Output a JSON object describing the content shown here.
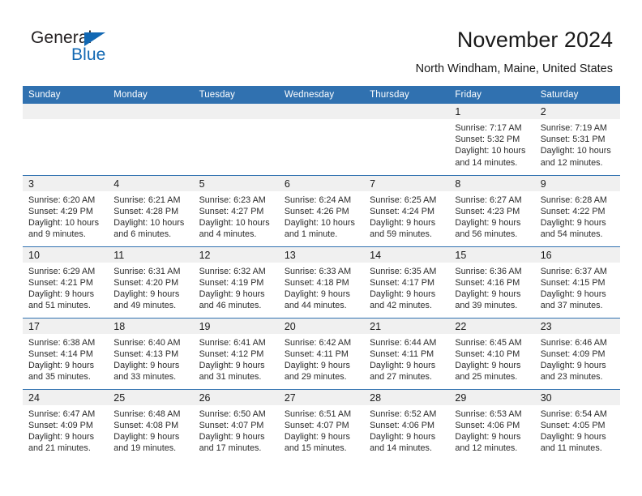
{
  "brand": {
    "name_part1": "General",
    "name_part2": "Blue",
    "accent_color": "#1268b3",
    "logo_icon": "triangle-icon"
  },
  "header": {
    "title": "November 2024",
    "subtitle": "North Windham, Maine, United States"
  },
  "calendar": {
    "header_color": "#3071b0",
    "daynum_band_color": "#f0f0f0",
    "columns": [
      "Sunday",
      "Monday",
      "Tuesday",
      "Wednesday",
      "Thursday",
      "Friday",
      "Saturday"
    ],
    "weeks": [
      [
        {
          "day": "",
          "empty": true
        },
        {
          "day": "",
          "empty": true
        },
        {
          "day": "",
          "empty": true
        },
        {
          "day": "",
          "empty": true
        },
        {
          "day": "",
          "empty": true
        },
        {
          "day": "1",
          "sunrise": "Sunrise: 7:17 AM",
          "sunset": "Sunset: 5:32 PM",
          "daylight": "Daylight: 10 hours and 14 minutes."
        },
        {
          "day": "2",
          "sunrise": "Sunrise: 7:19 AM",
          "sunset": "Sunset: 5:31 PM",
          "daylight": "Daylight: 10 hours and 12 minutes."
        }
      ],
      [
        {
          "day": "3",
          "sunrise": "Sunrise: 6:20 AM",
          "sunset": "Sunset: 4:29 PM",
          "daylight": "Daylight: 10 hours and 9 minutes."
        },
        {
          "day": "4",
          "sunrise": "Sunrise: 6:21 AM",
          "sunset": "Sunset: 4:28 PM",
          "daylight": "Daylight: 10 hours and 6 minutes."
        },
        {
          "day": "5",
          "sunrise": "Sunrise: 6:23 AM",
          "sunset": "Sunset: 4:27 PM",
          "daylight": "Daylight: 10 hours and 4 minutes."
        },
        {
          "day": "6",
          "sunrise": "Sunrise: 6:24 AM",
          "sunset": "Sunset: 4:26 PM",
          "daylight": "Daylight: 10 hours and 1 minute."
        },
        {
          "day": "7",
          "sunrise": "Sunrise: 6:25 AM",
          "sunset": "Sunset: 4:24 PM",
          "daylight": "Daylight: 9 hours and 59 minutes."
        },
        {
          "day": "8",
          "sunrise": "Sunrise: 6:27 AM",
          "sunset": "Sunset: 4:23 PM",
          "daylight": "Daylight: 9 hours and 56 minutes."
        },
        {
          "day": "9",
          "sunrise": "Sunrise: 6:28 AM",
          "sunset": "Sunset: 4:22 PM",
          "daylight": "Daylight: 9 hours and 54 minutes."
        }
      ],
      [
        {
          "day": "10",
          "sunrise": "Sunrise: 6:29 AM",
          "sunset": "Sunset: 4:21 PM",
          "daylight": "Daylight: 9 hours and 51 minutes."
        },
        {
          "day": "11",
          "sunrise": "Sunrise: 6:31 AM",
          "sunset": "Sunset: 4:20 PM",
          "daylight": "Daylight: 9 hours and 49 minutes."
        },
        {
          "day": "12",
          "sunrise": "Sunrise: 6:32 AM",
          "sunset": "Sunset: 4:19 PM",
          "daylight": "Daylight: 9 hours and 46 minutes."
        },
        {
          "day": "13",
          "sunrise": "Sunrise: 6:33 AM",
          "sunset": "Sunset: 4:18 PM",
          "daylight": "Daylight: 9 hours and 44 minutes."
        },
        {
          "day": "14",
          "sunrise": "Sunrise: 6:35 AM",
          "sunset": "Sunset: 4:17 PM",
          "daylight": "Daylight: 9 hours and 42 minutes."
        },
        {
          "day": "15",
          "sunrise": "Sunrise: 6:36 AM",
          "sunset": "Sunset: 4:16 PM",
          "daylight": "Daylight: 9 hours and 39 minutes."
        },
        {
          "day": "16",
          "sunrise": "Sunrise: 6:37 AM",
          "sunset": "Sunset: 4:15 PM",
          "daylight": "Daylight: 9 hours and 37 minutes."
        }
      ],
      [
        {
          "day": "17",
          "sunrise": "Sunrise: 6:38 AM",
          "sunset": "Sunset: 4:14 PM",
          "daylight": "Daylight: 9 hours and 35 minutes."
        },
        {
          "day": "18",
          "sunrise": "Sunrise: 6:40 AM",
          "sunset": "Sunset: 4:13 PM",
          "daylight": "Daylight: 9 hours and 33 minutes."
        },
        {
          "day": "19",
          "sunrise": "Sunrise: 6:41 AM",
          "sunset": "Sunset: 4:12 PM",
          "daylight": "Daylight: 9 hours and 31 minutes."
        },
        {
          "day": "20",
          "sunrise": "Sunrise: 6:42 AM",
          "sunset": "Sunset: 4:11 PM",
          "daylight": "Daylight: 9 hours and 29 minutes."
        },
        {
          "day": "21",
          "sunrise": "Sunrise: 6:44 AM",
          "sunset": "Sunset: 4:11 PM",
          "daylight": "Daylight: 9 hours and 27 minutes."
        },
        {
          "day": "22",
          "sunrise": "Sunrise: 6:45 AM",
          "sunset": "Sunset: 4:10 PM",
          "daylight": "Daylight: 9 hours and 25 minutes."
        },
        {
          "day": "23",
          "sunrise": "Sunrise: 6:46 AM",
          "sunset": "Sunset: 4:09 PM",
          "daylight": "Daylight: 9 hours and 23 minutes."
        }
      ],
      [
        {
          "day": "24",
          "sunrise": "Sunrise: 6:47 AM",
          "sunset": "Sunset: 4:09 PM",
          "daylight": "Daylight: 9 hours and 21 minutes."
        },
        {
          "day": "25",
          "sunrise": "Sunrise: 6:48 AM",
          "sunset": "Sunset: 4:08 PM",
          "daylight": "Daylight: 9 hours and 19 minutes."
        },
        {
          "day": "26",
          "sunrise": "Sunrise: 6:50 AM",
          "sunset": "Sunset: 4:07 PM",
          "daylight": "Daylight: 9 hours and 17 minutes."
        },
        {
          "day": "27",
          "sunrise": "Sunrise: 6:51 AM",
          "sunset": "Sunset: 4:07 PM",
          "daylight": "Daylight: 9 hours and 15 minutes."
        },
        {
          "day": "28",
          "sunrise": "Sunrise: 6:52 AM",
          "sunset": "Sunset: 4:06 PM",
          "daylight": "Daylight: 9 hours and 14 minutes."
        },
        {
          "day": "29",
          "sunrise": "Sunrise: 6:53 AM",
          "sunset": "Sunset: 4:06 PM",
          "daylight": "Daylight: 9 hours and 12 minutes."
        },
        {
          "day": "30",
          "sunrise": "Sunrise: 6:54 AM",
          "sunset": "Sunset: 4:05 PM",
          "daylight": "Daylight: 9 hours and 11 minutes."
        }
      ]
    ]
  }
}
